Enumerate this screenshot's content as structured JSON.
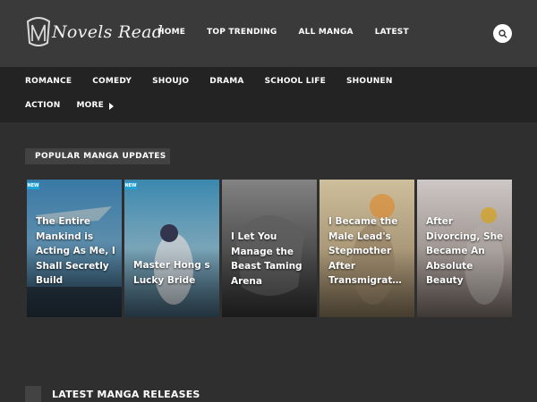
{
  "site": {
    "logo_text": "Novels Read"
  },
  "nav_main": [
    "HOME",
    "TOP TRENDING",
    "ALL MANGA",
    "LATEST"
  ],
  "subnav": {
    "row1": [
      "ROMANCE",
      "COMEDY",
      "SHOUJO",
      "DRAMA",
      "SCHOOL LIFE",
      "SHOUNEN"
    ],
    "row2": [
      "ACTION"
    ],
    "more_label": "MORE"
  },
  "popular": {
    "heading": "POPULAR MANGA UPDATES",
    "cards": [
      {
        "title": "The Entire Mankind is Acting As Me, I Shall Secretly Build",
        "badge": "NEW"
      },
      {
        "title": "Master Hong s Lucky Bride",
        "badge": "NEW"
      },
      {
        "title": "I Let You Manage the Beast Taming Arena"
      },
      {
        "title": "I Became the Male Lead's Stepmother After Transmigrat…"
      },
      {
        "title": "After Divorcing, She Became An Absolute Beauty"
      }
    ]
  },
  "latest": {
    "heading": "LATEST MANGA RELEASES"
  },
  "colors": {
    "header_bg": "#3a3a3a",
    "subnav_bg": "#232323",
    "page_bg": "#2f2f2f",
    "badge": "#1fa1d9"
  },
  "icons": {
    "search": "search-icon",
    "more": "caret-right-icon"
  }
}
